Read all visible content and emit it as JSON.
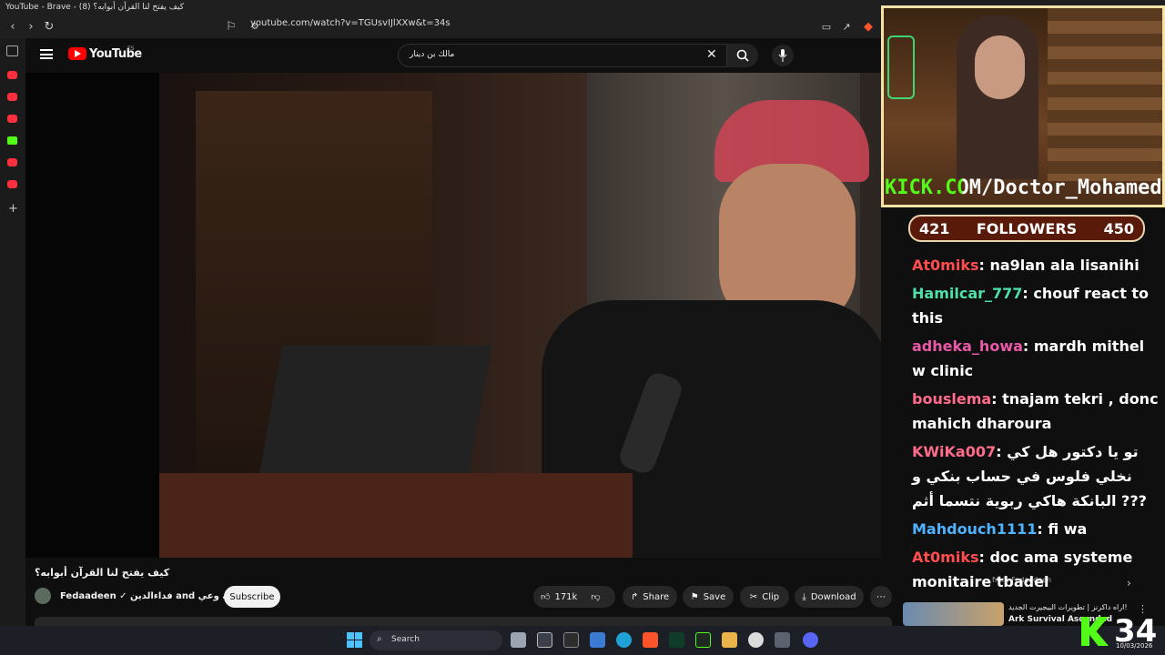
{
  "browser": {
    "window_title": "YouTube - Brave - كيف يفتح لنا القرآن أبوابه؟ (8)",
    "url": "youtube.com/watch?v=TGUsvIJlXXw&t=34s"
  },
  "youtube": {
    "logo_text": "YouTube",
    "region": "ES",
    "search_value": "مالك بن دينار",
    "video_title": "كيف يفتح لنا القرآن أبوابه؟",
    "channel": "Fedaadeen ✓ فداءالدين and مؤسسة وعي",
    "subscribe_label": "Subscribe",
    "likes": "171k",
    "share_label": "Share",
    "save_label": "Save",
    "clip_label": "Clip",
    "download_label": "Download",
    "suggest_prefix": "from Fedaadeen",
    "suggest_title_1": "اراه داكرنز | تطويرات البيجيرت الجديد!",
    "suggest_title_2": "Ark Survival Ascended"
  },
  "overlay": {
    "kick_url": "KICK.COM/Doctor_Mohamed",
    "followers_current": "421",
    "followers_label": "FOLLOWERS",
    "followers_goal": "450",
    "big_count": "34",
    "date": "10/03/2026"
  },
  "chat": [
    {
      "user": "At0miks",
      "text": ": na9lan ala lisanihi"
    },
    {
      "user": "Hamilcar_777",
      "text": ": chouf react to this"
    },
    {
      "user": "adheka_howa",
      "text": ": mardh mithel w clinic"
    },
    {
      "user": "bouslema",
      "text": ": tnajam tekri , donc mahich dharoura"
    },
    {
      "user": "KWiKa007",
      "text": ": تو يا دكتور هل كي نخلي فلوس في حساب بنكي و البانكة هاكي ربوية نتسما أثم ???"
    },
    {
      "user": "Mahdouch1111",
      "text": ": fi wa"
    },
    {
      "user": "At0miks",
      "text": ": doc ama systeme monitaire tbadel"
    }
  ],
  "taskbar": {
    "search_label": "Search"
  }
}
